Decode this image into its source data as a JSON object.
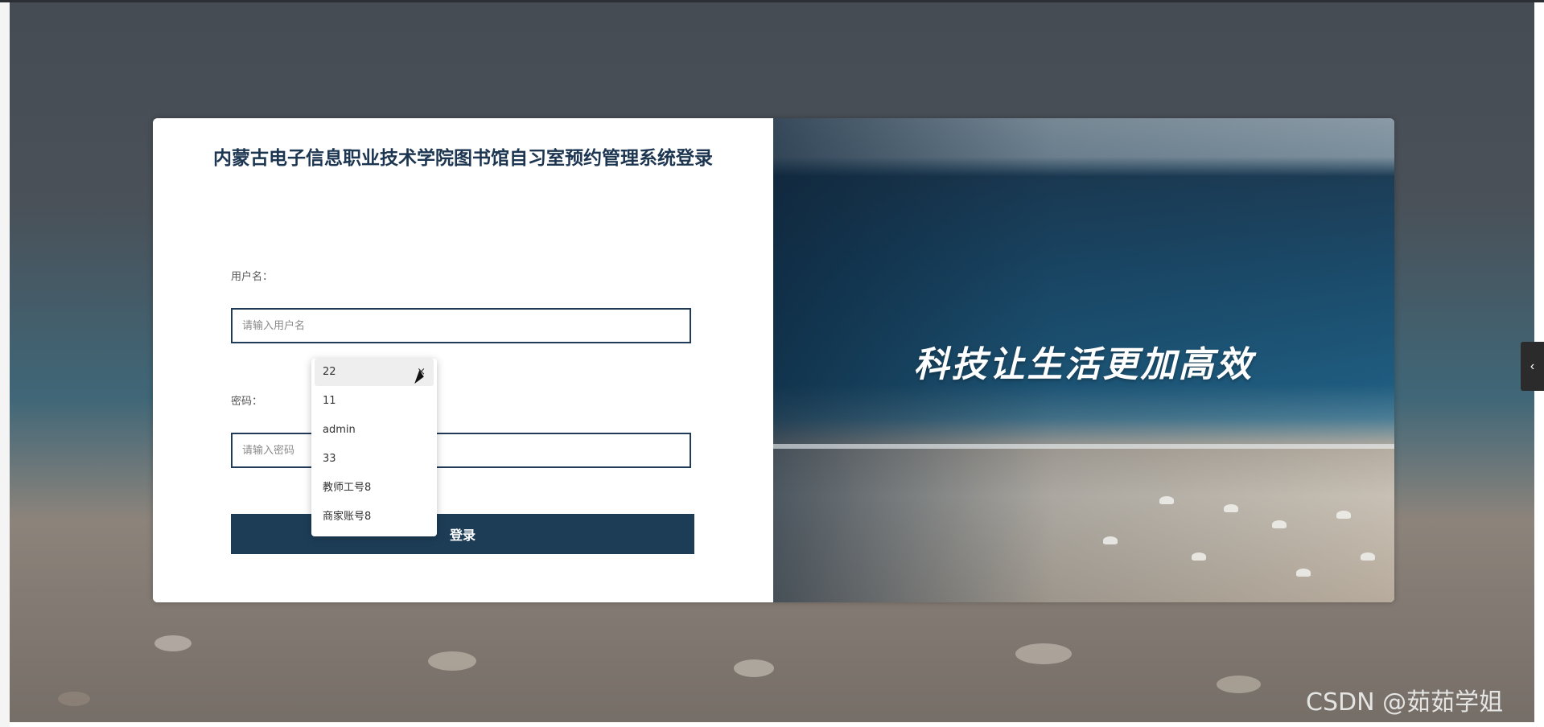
{
  "login": {
    "title": "内蒙古电子信息职业技术学院图书馆自习室预约管理系统登录",
    "username_label": "用户名：",
    "username_placeholder": "请输入用户名",
    "password_label": "密码：",
    "password_placeholder": "请输入密码",
    "submit_label": "登录"
  },
  "autocomplete": {
    "items": [
      "22",
      "11",
      "admin",
      "33",
      "教师工号8",
      "商家账号8"
    ],
    "active_index": 0,
    "clear_glyph": "×"
  },
  "banner": {
    "slogan": "科技让生活更加高效"
  },
  "side_tab": {
    "icon": "chevron-left-icon",
    "glyph": "‹"
  },
  "watermark": {
    "text": "CSDN @茹茹学姐"
  },
  "colors": {
    "primary": "#1d3d57",
    "input_border": "#1f3b57",
    "title": "#1c3550"
  }
}
